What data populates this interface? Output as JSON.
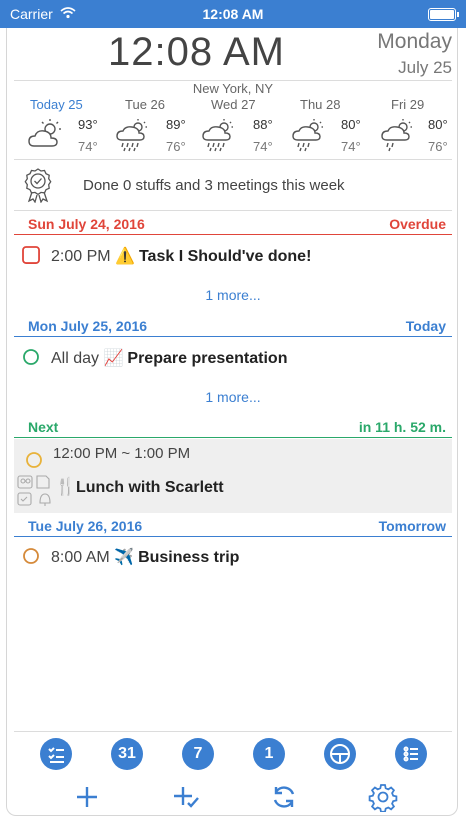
{
  "status_bar": {
    "carrier": "Carrier",
    "time": "12:08 AM"
  },
  "header": {
    "clock": "12:08 AM",
    "day_name": "Monday",
    "date": "July 25",
    "location": "New York, NY"
  },
  "weather": [
    {
      "day": "Today 25",
      "high": "93°",
      "low": "74°",
      "icon": "partly-cloudy-icon"
    },
    {
      "day": "Tue 26",
      "high": "89°",
      "low": "76°",
      "icon": "rain-icon"
    },
    {
      "day": "Wed 27",
      "high": "88°",
      "low": "74°",
      "icon": "rain-icon"
    },
    {
      "day": "Thu 28",
      "high": "80°",
      "low": "74°",
      "icon": "rain-icon"
    },
    {
      "day": "Fri 29",
      "high": "80°",
      "low": "76°",
      "icon": "rain-icon"
    }
  ],
  "summary": {
    "text": "Done 0 stuffs and 3 meetings this week",
    "icon": "award-ribbon-icon"
  },
  "sections": [
    {
      "left": "Sun  July 24, 2016",
      "right": "Overdue",
      "color": "#e0453a"
    },
    {
      "left": "Mon  July 25, 2016",
      "right": "Today",
      "color": "#3b7fd1"
    },
    {
      "left": "Next",
      "right": "in 11 h. 52 m.",
      "color": "#2aa86a"
    },
    {
      "left": "Tue  July 26, 2016",
      "right": "Tomorrow",
      "color": "#3b7fd1"
    }
  ],
  "tasks": {
    "overdue": {
      "time": "2:00 PM",
      "emoji": "⚠️",
      "title": "Task I Should've done!"
    },
    "today": {
      "time": "All day",
      "emoji": "📈",
      "title": "Prepare presentation"
    },
    "next": {
      "time": "12:00 PM ~ 1:00 PM",
      "emoji": "🍴",
      "title": "Lunch with Scarlett"
    },
    "tomorrow": {
      "time": "8:00 AM",
      "emoji": "✈️",
      "title": "Business trip"
    }
  },
  "more_label": "1 more...",
  "toolbar": {
    "row1": [
      "checklist-icon",
      "31",
      "7",
      "1",
      "theater-icon",
      "list-icon"
    ],
    "row2": [
      "add-icon",
      "add-check-icon",
      "refresh-icon",
      "settings-gear-icon"
    ]
  },
  "colors": {
    "accent": "#3b7fd1",
    "overdue": "#e0453a",
    "next": "#2aa86a",
    "pending": "#e8b23a",
    "tomorrow_task": "#d58a3a"
  }
}
